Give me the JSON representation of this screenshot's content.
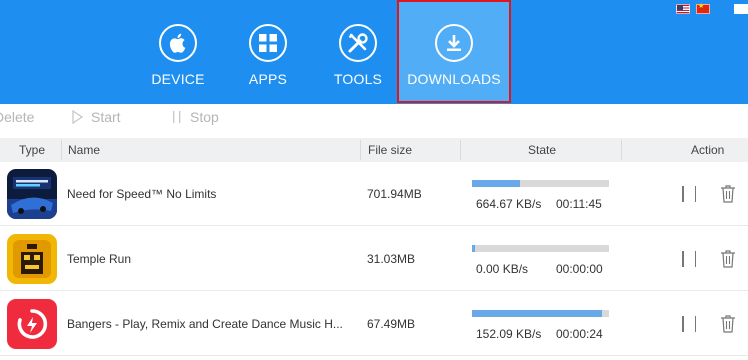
{
  "nav": {
    "device_label": "DEVICE",
    "apps_label": "APPS",
    "tools_label": "TOOLS",
    "downloads_label": "DOWNLOADS"
  },
  "toolbar": {
    "delete_label": "Delete",
    "start_label": "Start",
    "stop_label": "Stop"
  },
  "table": {
    "headers": {
      "type": "Type",
      "name": "Name",
      "file_size": "File size",
      "state": "State",
      "action": "Action"
    },
    "rows": [
      {
        "name": "Need for Speed™ No Limits",
        "file_size": "701.94MB",
        "speed": "664.67 KB/s",
        "eta": "00:11:45",
        "progress": 0.35,
        "icon": "need-for-speed-app-icon"
      },
      {
        "name": "Temple Run",
        "file_size": "31.03MB",
        "speed": "0.00 KB/s",
        "eta": "00:00:00",
        "progress": 0.02,
        "icon": "temple-run-app-icon"
      },
      {
        "name": "Bangers - Play, Remix and Create Dance Music H...",
        "file_size": "67.49MB",
        "speed": "152.09 KB/s",
        "eta": "00:00:24",
        "progress": 0.95,
        "icon": "bangers-app-icon"
      }
    ]
  },
  "colors": {
    "header_bg": "#1e8ff0",
    "active_tab_bg": "#52adf7",
    "highlight_border": "#e0161c",
    "progress_fill": "#6aa9e9",
    "progress_track": "#d9d9d9"
  }
}
